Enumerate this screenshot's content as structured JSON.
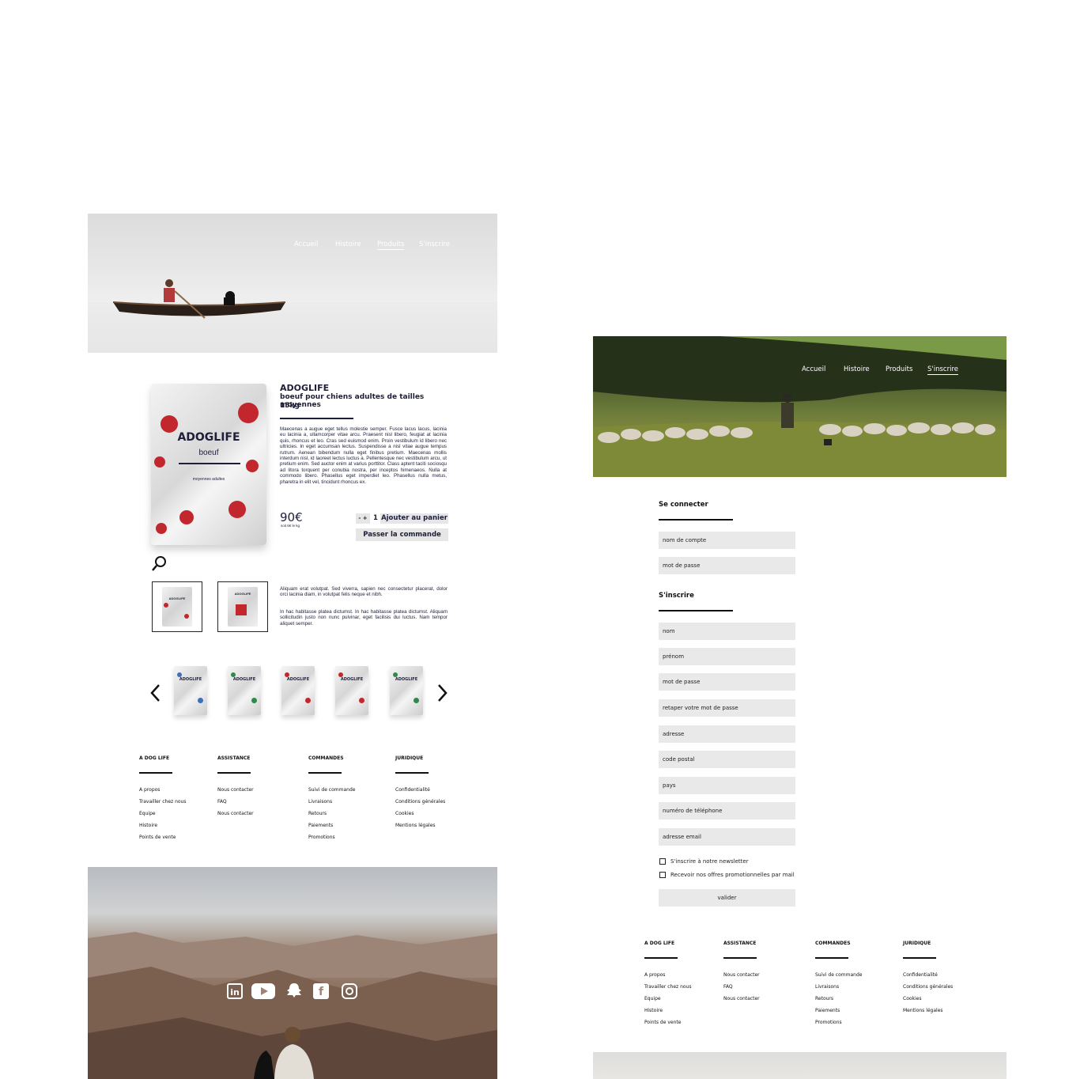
{
  "left_page": {
    "nav": [
      "Accueil",
      "Histoire",
      "Produits",
      "S'inscrire"
    ],
    "nav_active": "Produits",
    "product": {
      "brand": "ADOGLIFE",
      "subtitle": "boeuf pour chiens adultes de tailles moyennes",
      "weight": "15kg",
      "description": "Maecenas a augue eget tellus molestie semper. Fusce lacus lacus, lacinia eu lacinia a, ullamcorper vitae arcu. Praesent nisl libero, feugiat at lacinia quis, rhoncus et leo. Cras sed euismod enim. Proin vestibulum id libero nec ultricies. In eget accumsan lectus. Suspendisse a nisl vitae augue tempus rutrum. Aenean bibendum nulla eget finibus pretium. Maecenas mollis interdum nisl, id laoreet lectus luctus a. Pellentesque nec vestibulum arcu, ut pretium enim. Sed auctor enim at varius porttitor. Class aptent taciti sociosqu ad litora torquent per conubia nostra, per inceptos himenaeos. Nulla at commodo libero. Phasellus eget imperdiet leo. Phasellus nulla metus, pharetra in elit vel, tincidunt rhoncus ex.",
      "price": "90€",
      "price_per_kg": "soit 6€ le kg",
      "qty_controls": "- +",
      "qty": "1",
      "add_to_cart": "Ajouter au panier",
      "checkout": "Passer la commande",
      "package_brand": "ADOGLIFE",
      "package_flavor": "boeuf",
      "package_size": "moyennes adultes",
      "extra_text_1": "Aliquam erat volutpat. Sed viverra, sapien nec consectetur placerat, dolor orci lacinia diam, in volutpat felis neque et nibh.",
      "extra_text_2": "In hac habitasse platea dictumst. In hac habitasse platea dictumst. Aliquam sollicitudin justo non nunc pulvinar, eget facilisis dui luctus. Nam tempor aliquet semper."
    },
    "thumbnail_brand": "ADOGLIFE",
    "carousel": [
      {
        "brand": "ADOGLIFE",
        "accent": "#3f6fb5"
      },
      {
        "brand": "ADOGLIFE",
        "accent": "#2f8a4a"
      },
      {
        "brand": "ADOGLIFE",
        "accent": "#c1272d"
      },
      {
        "brand": "ADOGLIFE",
        "accent": "#c1272d"
      },
      {
        "brand": "ADOGLIFE",
        "accent": "#2f8a4a"
      }
    ]
  },
  "footer": {
    "columns": [
      {
        "title": "A DOG LIFE",
        "links": [
          "A propos",
          "Travailler chez nous",
          "Equipe",
          "Histoire",
          "Points de vente"
        ]
      },
      {
        "title": "ASSISTANCE",
        "links": [
          "Nous contacter",
          "FAQ",
          "Nous contacter"
        ]
      },
      {
        "title": "COMMANDES",
        "links": [
          "Suivi de commande",
          "Livraisons",
          "Retours",
          "Paiements",
          "Promotions"
        ]
      },
      {
        "title": "JURIDIQUE",
        "links": [
          "Confidentialité",
          "Conditions générales",
          "Cookies",
          "Mentions légales"
        ]
      }
    ]
  },
  "social": [
    "linkedin-icon",
    "youtube-icon",
    "snapchat-icon",
    "facebook-icon",
    "instagram-icon"
  ],
  "right_page": {
    "nav": [
      "Accueil",
      "Histoire",
      "Produits",
      "S'inscrire"
    ],
    "nav_active": "S'inscrire",
    "login_title": "Se connecter",
    "login_fields": [
      "nom de compte",
      "mot de passe"
    ],
    "signup_title": "S'inscrire",
    "signup_fields": [
      "nom",
      "prénom",
      "mot de passe",
      "retaper votre mot de passe",
      "adresse",
      "code postal",
      "pays",
      "numéro de téléphone",
      "adresse email"
    ],
    "newsletter": "S'inscrire à notre newsletter",
    "promo": "Recevoir nos offres promotionnelles par mail",
    "submit": "valider"
  },
  "colors": {
    "brand_red": "#c1272d",
    "navy": "#1d1f3a",
    "field_grey": "#e9e9e9"
  }
}
